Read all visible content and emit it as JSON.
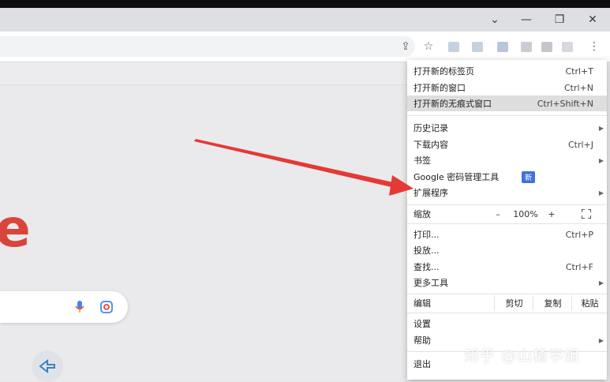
{
  "window": {
    "minimize_icon": "minimize-icon",
    "restore_icon": "restore-icon",
    "close_icon": "close-icon",
    "tabs_dropdown_icon": "chevron-down-icon"
  },
  "toolbar": {
    "share_icon": "share-icon",
    "star_icon": "star-icon",
    "more_icon": "kebab-menu-icon"
  },
  "page": {
    "logo_letter": "e"
  },
  "menu": {
    "new_tab": {
      "label": "打开新的标签页",
      "shortcut": "Ctrl+T"
    },
    "new_window": {
      "label": "打开新的窗口",
      "shortcut": "Ctrl+N"
    },
    "new_incognito": {
      "label": "打开新的无痕式窗口",
      "shortcut": "Ctrl+Shift+N"
    },
    "history": {
      "label": "历史记录"
    },
    "downloads": {
      "label": "下载内容",
      "shortcut": "Ctrl+J"
    },
    "bookmarks": {
      "label": "书签"
    },
    "password_manager": {
      "label": "Google 密码管理工具",
      "badge": "新"
    },
    "extensions": {
      "label": "扩展程序"
    },
    "zoom": {
      "label": "缩放",
      "minus": "–",
      "value": "100%",
      "plus": "+"
    },
    "print": {
      "label": "打印...",
      "shortcut": "Ctrl+P"
    },
    "cast": {
      "label": "投放..."
    },
    "find": {
      "label": "查找...",
      "shortcut": "Ctrl+F"
    },
    "more_tools": {
      "label": "更多工具"
    },
    "edit": {
      "label": "编辑",
      "cut": "剪切",
      "copy": "复制",
      "paste": "粘贴"
    },
    "settings": {
      "label": "设置"
    },
    "help": {
      "label": "帮助"
    },
    "exit": {
      "label": "退出"
    }
  },
  "watermark": "知乎 @山楂学姐",
  "colors": {
    "arrow": "#e53935",
    "badge": "#3f73d6",
    "highlight": "#dedede"
  }
}
